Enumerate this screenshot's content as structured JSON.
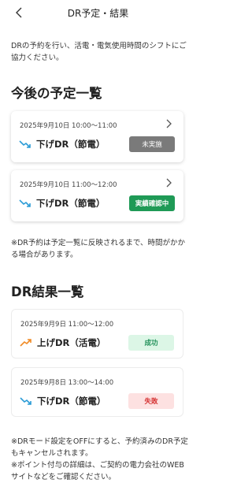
{
  "header": {
    "title": "DR予定・結果",
    "back_icon": "chevron-left-icon"
  },
  "intro_text": "DRの予約を行い、活電・電気使用時間のシフトにご協力ください。",
  "upcoming": {
    "title": "今後の予定一覧",
    "items": [
      {
        "time": "2025年9月10日  10:00～11:00",
        "label": "下げDR（節電）",
        "status": "未実施",
        "icon": "trend-down-icon"
      },
      {
        "time": "2025年9月10日  11:00～12:00",
        "label": "下げDR（節電）",
        "status": "実績確認中",
        "icon": "trend-down-icon"
      }
    ],
    "note": "※DR予約は予定一覧に反映されるまで、時間がかかる場合があります。"
  },
  "results": {
    "title": "DR結果一覧",
    "items": [
      {
        "time": "2025年9月9日  11:00～12:00",
        "label": "上げDR（活電）",
        "status": "成功",
        "icon": "trend-up-icon"
      },
      {
        "time": "2025年9月8日  13:00～14:00",
        "label": "下げDR（節電）",
        "status": "失敗",
        "icon": "trend-down-icon"
      }
    ]
  },
  "footer_note": "※DRモード設定をOFFにすると、予約済みのDR予定もキャンセルされます。\n※ポイント付与の詳細は、ご契約の電力会社のWEBサイトなどをご確認ください。",
  "colors": {
    "down_arrow": "#2a9bd6",
    "up_arrow": "#f08a24",
    "gray_badge": "#7a7a7a",
    "green_badge": "#1f9a56",
    "success_bg": "#dcf6e6",
    "fail_bg": "#fde1e1"
  }
}
